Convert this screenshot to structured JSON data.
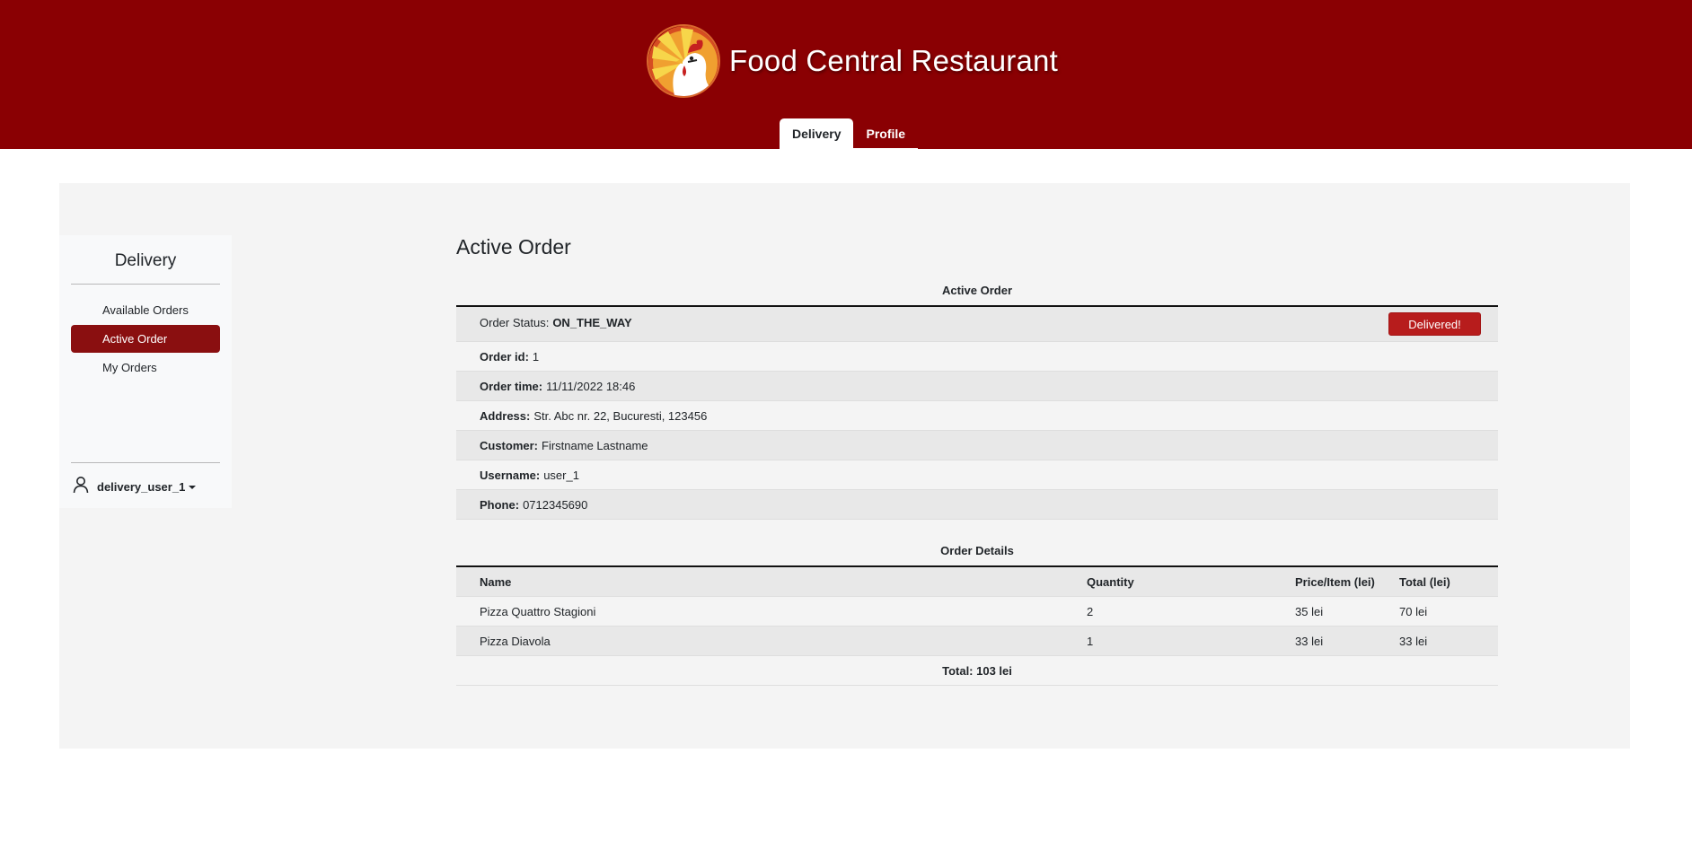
{
  "header": {
    "brand_name": "Food Central Restaurant",
    "tabs": [
      {
        "label": "Delivery",
        "active": true
      },
      {
        "label": "Profile",
        "active": false
      }
    ]
  },
  "sidebar": {
    "title": "Delivery",
    "items": [
      {
        "label": "Available Orders",
        "active": false
      },
      {
        "label": "Active Order",
        "active": true
      },
      {
        "label": "My Orders",
        "active": false
      }
    ],
    "user": {
      "name": "delivery_user_1",
      "icon": "user-icon"
    }
  },
  "main": {
    "title": "Active Order",
    "order_table": {
      "caption": "Active Order",
      "status_label": "Order Status:",
      "status_value": "ON_THE_WAY",
      "delivered_button": "Delivered!",
      "fields": [
        {
          "label": "Order id:",
          "value": "1"
        },
        {
          "label": "Order time:",
          "value": "11/11/2022 18:46"
        },
        {
          "label": "Address:",
          "value": "Str. Abc nr. 22, Bucuresti, 123456"
        },
        {
          "label": "Customer:",
          "value": "Firstname Lastname"
        },
        {
          "label": "Username:",
          "value": "user_1"
        },
        {
          "label": "Phone:",
          "value": "0712345690"
        }
      ]
    },
    "details_table": {
      "caption": "Order Details",
      "columns": [
        "Name",
        "Quantity",
        "Price/Item (lei)",
        "Total (lei)"
      ],
      "rows": [
        [
          "Pizza Quattro Stagioni",
          "2",
          "35 lei",
          "70 lei"
        ],
        [
          "Pizza Diavola",
          "1",
          "33 lei",
          "33 lei"
        ]
      ],
      "total": "Total: 103 lei"
    }
  },
  "colors": {
    "header_bg": "#8a0003",
    "accent": "#8a0f10",
    "button": "#b71c1c",
    "panel_bg": "#f4f4f4"
  }
}
